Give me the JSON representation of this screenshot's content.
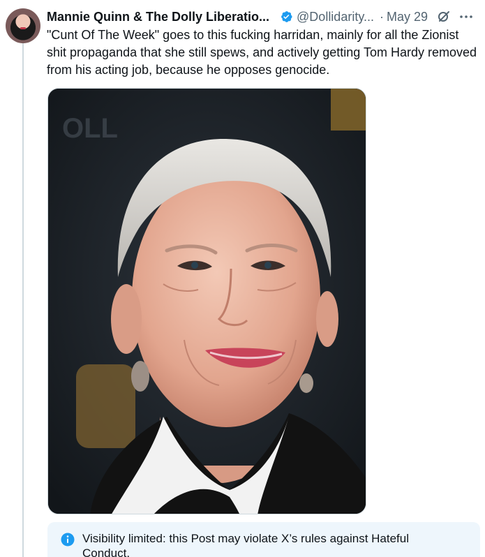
{
  "post": {
    "display_name": "Mannie Quinn & The Dolly Liberatio...",
    "handle": "@Dollidarity...",
    "separator": "·",
    "date": "May 29",
    "text": "\"Cunt Of The Week\" goes to this fucking harridan, mainly for all the Zionist shit propaganda that she still spews, and actively getting Tom Hardy removed from his acting job, because he opposes genocide."
  },
  "notice": {
    "text": "Visibility limited: this Post may violate X’s rules against Hateful Conduct."
  },
  "colors": {
    "verified_blue": "#1d9bf0",
    "text_secondary": "#536471",
    "notice_background": "#eef6fc"
  },
  "icons": {
    "verified": "verified-badge-icon",
    "grok": "grok-icon",
    "more": "more-icon",
    "info": "info-icon"
  }
}
